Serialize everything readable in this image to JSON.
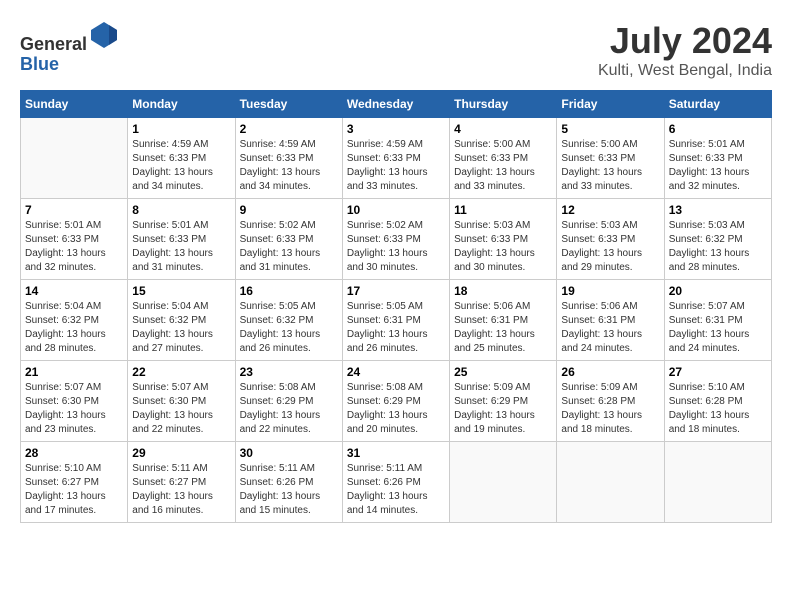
{
  "header": {
    "logo_line1": "General",
    "logo_line2": "Blue",
    "title": "July 2024",
    "subtitle": "Kulti, West Bengal, India"
  },
  "weekdays": [
    "Sunday",
    "Monday",
    "Tuesday",
    "Wednesday",
    "Thursday",
    "Friday",
    "Saturday"
  ],
  "weeks": [
    [
      {
        "day": "",
        "info": ""
      },
      {
        "day": "1",
        "info": "Sunrise: 4:59 AM\nSunset: 6:33 PM\nDaylight: 13 hours\nand 34 minutes."
      },
      {
        "day": "2",
        "info": "Sunrise: 4:59 AM\nSunset: 6:33 PM\nDaylight: 13 hours\nand 34 minutes."
      },
      {
        "day": "3",
        "info": "Sunrise: 4:59 AM\nSunset: 6:33 PM\nDaylight: 13 hours\nand 33 minutes."
      },
      {
        "day": "4",
        "info": "Sunrise: 5:00 AM\nSunset: 6:33 PM\nDaylight: 13 hours\nand 33 minutes."
      },
      {
        "day": "5",
        "info": "Sunrise: 5:00 AM\nSunset: 6:33 PM\nDaylight: 13 hours\nand 33 minutes."
      },
      {
        "day": "6",
        "info": "Sunrise: 5:01 AM\nSunset: 6:33 PM\nDaylight: 13 hours\nand 32 minutes."
      }
    ],
    [
      {
        "day": "7",
        "info": "Sunrise: 5:01 AM\nSunset: 6:33 PM\nDaylight: 13 hours\nand 32 minutes."
      },
      {
        "day": "8",
        "info": "Sunrise: 5:01 AM\nSunset: 6:33 PM\nDaylight: 13 hours\nand 31 minutes."
      },
      {
        "day": "9",
        "info": "Sunrise: 5:02 AM\nSunset: 6:33 PM\nDaylight: 13 hours\nand 31 minutes."
      },
      {
        "day": "10",
        "info": "Sunrise: 5:02 AM\nSunset: 6:33 PM\nDaylight: 13 hours\nand 30 minutes."
      },
      {
        "day": "11",
        "info": "Sunrise: 5:03 AM\nSunset: 6:33 PM\nDaylight: 13 hours\nand 30 minutes."
      },
      {
        "day": "12",
        "info": "Sunrise: 5:03 AM\nSunset: 6:33 PM\nDaylight: 13 hours\nand 29 minutes."
      },
      {
        "day": "13",
        "info": "Sunrise: 5:03 AM\nSunset: 6:32 PM\nDaylight: 13 hours\nand 28 minutes."
      }
    ],
    [
      {
        "day": "14",
        "info": "Sunrise: 5:04 AM\nSunset: 6:32 PM\nDaylight: 13 hours\nand 28 minutes."
      },
      {
        "day": "15",
        "info": "Sunrise: 5:04 AM\nSunset: 6:32 PM\nDaylight: 13 hours\nand 27 minutes."
      },
      {
        "day": "16",
        "info": "Sunrise: 5:05 AM\nSunset: 6:32 PM\nDaylight: 13 hours\nand 26 minutes."
      },
      {
        "day": "17",
        "info": "Sunrise: 5:05 AM\nSunset: 6:31 PM\nDaylight: 13 hours\nand 26 minutes."
      },
      {
        "day": "18",
        "info": "Sunrise: 5:06 AM\nSunset: 6:31 PM\nDaylight: 13 hours\nand 25 minutes."
      },
      {
        "day": "19",
        "info": "Sunrise: 5:06 AM\nSunset: 6:31 PM\nDaylight: 13 hours\nand 24 minutes."
      },
      {
        "day": "20",
        "info": "Sunrise: 5:07 AM\nSunset: 6:31 PM\nDaylight: 13 hours\nand 24 minutes."
      }
    ],
    [
      {
        "day": "21",
        "info": "Sunrise: 5:07 AM\nSunset: 6:30 PM\nDaylight: 13 hours\nand 23 minutes."
      },
      {
        "day": "22",
        "info": "Sunrise: 5:07 AM\nSunset: 6:30 PM\nDaylight: 13 hours\nand 22 minutes."
      },
      {
        "day": "23",
        "info": "Sunrise: 5:08 AM\nSunset: 6:29 PM\nDaylight: 13 hours\nand 22 minutes."
      },
      {
        "day": "24",
        "info": "Sunrise: 5:08 AM\nSunset: 6:29 PM\nDaylight: 13 hours\nand 20 minutes."
      },
      {
        "day": "25",
        "info": "Sunrise: 5:09 AM\nSunset: 6:29 PM\nDaylight: 13 hours\nand 19 minutes."
      },
      {
        "day": "26",
        "info": "Sunrise: 5:09 AM\nSunset: 6:28 PM\nDaylight: 13 hours\nand 18 minutes."
      },
      {
        "day": "27",
        "info": "Sunrise: 5:10 AM\nSunset: 6:28 PM\nDaylight: 13 hours\nand 18 minutes."
      }
    ],
    [
      {
        "day": "28",
        "info": "Sunrise: 5:10 AM\nSunset: 6:27 PM\nDaylight: 13 hours\nand 17 minutes."
      },
      {
        "day": "29",
        "info": "Sunrise: 5:11 AM\nSunset: 6:27 PM\nDaylight: 13 hours\nand 16 minutes."
      },
      {
        "day": "30",
        "info": "Sunrise: 5:11 AM\nSunset: 6:26 PM\nDaylight: 13 hours\nand 15 minutes."
      },
      {
        "day": "31",
        "info": "Sunrise: 5:11 AM\nSunset: 6:26 PM\nDaylight: 13 hours\nand 14 minutes."
      },
      {
        "day": "",
        "info": ""
      },
      {
        "day": "",
        "info": ""
      },
      {
        "day": "",
        "info": ""
      }
    ]
  ]
}
